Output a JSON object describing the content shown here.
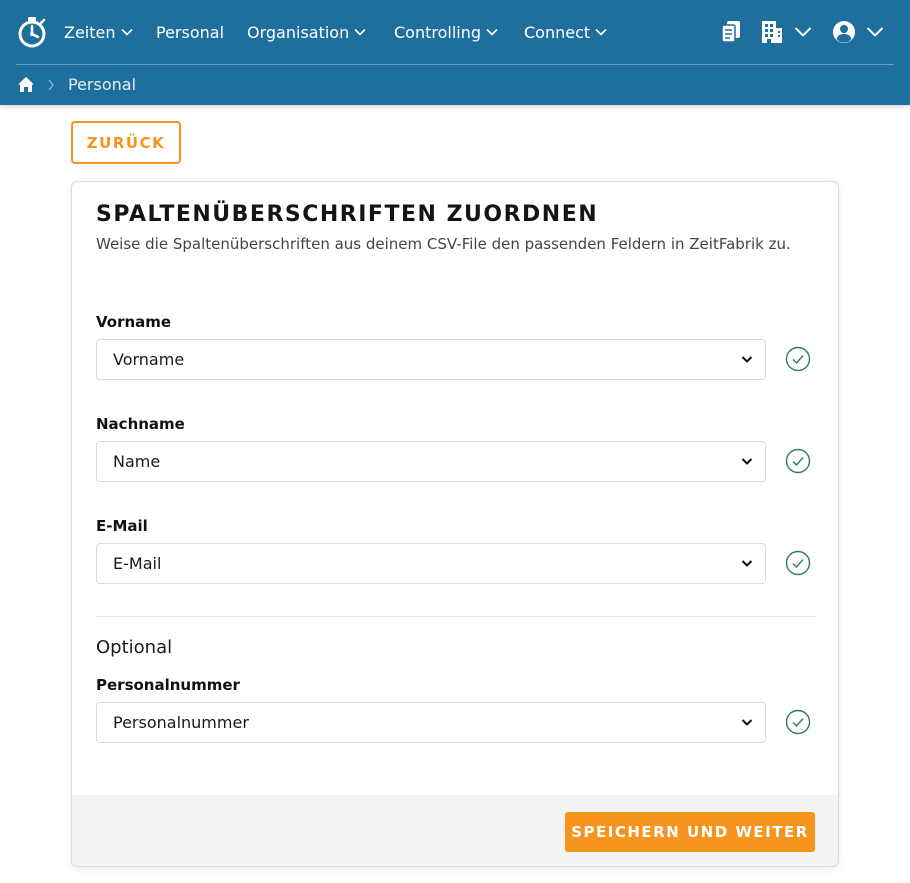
{
  "header": {
    "nav": [
      {
        "label": "Zeiten",
        "dropdown": true
      },
      {
        "label": "Personal",
        "dropdown": false
      },
      {
        "label": "Organisation",
        "dropdown": true
      },
      {
        "label": "Controlling",
        "dropdown": true
      },
      {
        "label": "Connect",
        "dropdown": true
      }
    ],
    "icons": [
      "logo-icon",
      "documents-icon",
      "building-icon",
      "user-icon"
    ],
    "background_color": "#1f6f9e"
  },
  "breadcrumb": {
    "home_icon": "home-icon",
    "current": "Personal"
  },
  "back_button": "ZURÜCK",
  "card": {
    "title": "SPALTENÜBERSCHRIFTEN ZUORDNEN",
    "subtitle": "Weise die Spaltenüberschriften aus deinem CSV-File den passenden Feldern in ZeitFabrik zu.",
    "fields": [
      {
        "label": "Vorname",
        "value": "Vorname",
        "valid": true
      },
      {
        "label": "Nachname",
        "value": "Name",
        "valid": true
      },
      {
        "label": "E-Mail",
        "value": "E-Mail",
        "valid": true
      }
    ],
    "optional_heading": "Optional",
    "optional_fields": [
      {
        "label": "Personalnummer",
        "value": "Personalnummer",
        "valid": true
      }
    ],
    "save_button": "SPEICHERN UND WEITER"
  },
  "colors": {
    "accent": "#f7941d",
    "header": "#1f6f9e",
    "valid": "#2e7d5b"
  }
}
